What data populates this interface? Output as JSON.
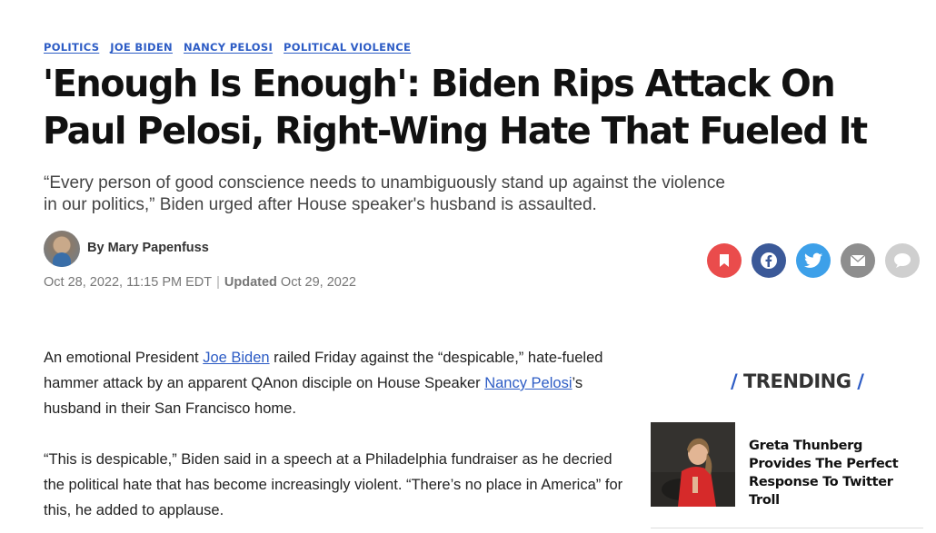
{
  "tags": [
    "POLITICS",
    "JOE BIDEN",
    "NANCY PELOSI",
    "POLITICAL VIOLENCE"
  ],
  "headline": "'Enough Is Enough': Biden Rips Attack On Paul Pelosi, Right-Wing Hate That Fueled It",
  "dek": "“Every person of good conscience needs to unambiguously stand up against the violence in our politics,” Biden urged after House speaker's husband is assaulted.",
  "byline": {
    "prefix": "By",
    "author": "Mary Papenfuss"
  },
  "dateline": {
    "published": "Oct 28, 2022, 11:15 PM EDT",
    "separator": "|",
    "updated_label": "Updated",
    "updated": "Oct 29, 2022"
  },
  "share_icons": [
    "bookmark-icon",
    "facebook-icon",
    "twitter-icon",
    "email-icon",
    "comment-icon"
  ],
  "colors": {
    "link": "#2d5cc5",
    "bookmark": "#ea4c4c",
    "facebook": "#3b5998",
    "twitter": "#3da0e9",
    "email": "#8e8e8e",
    "comment": "#cfcfcf"
  },
  "article": {
    "p1": {
      "t1": "An emotional President ",
      "link1": "Joe Biden",
      "t2": " railed Friday against the “despicable,” hate-fueled hammer attack by an apparent QAnon disciple on House Speaker ",
      "link2": "Nancy Pelosi",
      "t3": "’s husband in their San Francisco home."
    },
    "p2": "“This is despicable,” Biden said in a speech at a Philadelphia fundraiser as he decried the political hate that has become increasingly violent. “There’s no place in America” for this, he added to applause."
  },
  "trending": {
    "slash_left": "/",
    "heading": "TRENDING",
    "slash_right": "/",
    "items": [
      {
        "title": "Greta Thunberg Provides The Perfect Response To Twitter Troll"
      }
    ]
  }
}
